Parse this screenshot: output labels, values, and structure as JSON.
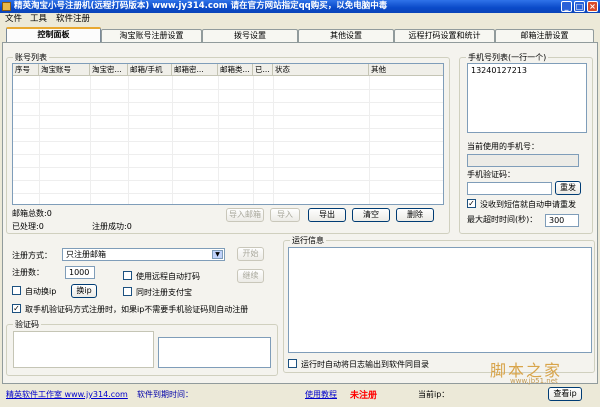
{
  "window": {
    "title": "精英淘宝小号注册机(远程打码版本)   www.jy314.com   请在官方网站指定qq购买，以免电脑中毒"
  },
  "menu": [
    "文件",
    "工具",
    "软件注册"
  ],
  "tabs": [
    {
      "label": "控制面板",
      "active": true
    },
    {
      "label": "淘宝账号注册设置",
      "active": false
    },
    {
      "label": "拨号设置",
      "active": false
    },
    {
      "label": "其他设置",
      "active": false
    },
    {
      "label": "远程打码设置和统计",
      "active": false
    },
    {
      "label": "邮箱注册设置",
      "active": false
    }
  ],
  "accounts": {
    "group_label": "账号列表",
    "columns": [
      "序号",
      "淘宝账号",
      "淘宝密...",
      "邮箱/手机",
      "邮箱密...",
      "邮箱类...",
      "已...",
      "状态",
      "其他"
    ],
    "rows": []
  },
  "stats": {
    "email_total": "邮箱总数:0",
    "processed": "已处理:0",
    "registered_ok": "注册成功:0"
  },
  "list_buttons": [
    "导入邮箱",
    "导入",
    "导出",
    "清空",
    "删除"
  ],
  "phones": {
    "group_label": "手机号列表(一行一个)",
    "list_value": "13240127213",
    "current_label": "当前使用的手机号：",
    "current_value": "",
    "code_label": "手机验证码：",
    "code_value": "",
    "resend_button": "重发",
    "auto_resend_label": "没收到短信就自动申请重发",
    "auto_resend_checked": true,
    "timeout_label": "最大超时时间(秒)：",
    "timeout_value": "300"
  },
  "registration": {
    "method_label": "注册方式：",
    "method_value": "只注册邮箱",
    "count_label": "注册数：",
    "count_value": "1000",
    "start_button": "开始",
    "stop_button": "继续",
    "auto_ip_label": "自动换ip",
    "auto_ip_checked": false,
    "change_ip_button": "换ip",
    "remote_captcha_label": "使用远程自动打码",
    "remote_captcha_checked": false,
    "alipay_label": "同时注册支付宝",
    "alipay_checked": false,
    "note_label": "取手机验证码方式注册时，如果ip不需要手机验证码则自动注册",
    "note_checked": true
  },
  "captcha": {
    "group_label": "验证码"
  },
  "log": {
    "group_label": "运行信息",
    "auto_export_label": "运行时自动将日志输出到软件同目录",
    "auto_export_checked": false
  },
  "status": {
    "studio_link": "精英软件工作室 www.jy314.com",
    "expire_label": "软件到期时间：",
    "tutorial_link": "使用教程",
    "reg_status": "未注册",
    "ip_label": "当前ip：",
    "view_button": "查看ip"
  },
  "watermark": {
    "cn": "脚本之家",
    "url": "www.jb51.net"
  },
  "colors": {
    "accent_red": "#ff0000",
    "link": "#0000cc",
    "title_blue": "#0a4ac9"
  }
}
